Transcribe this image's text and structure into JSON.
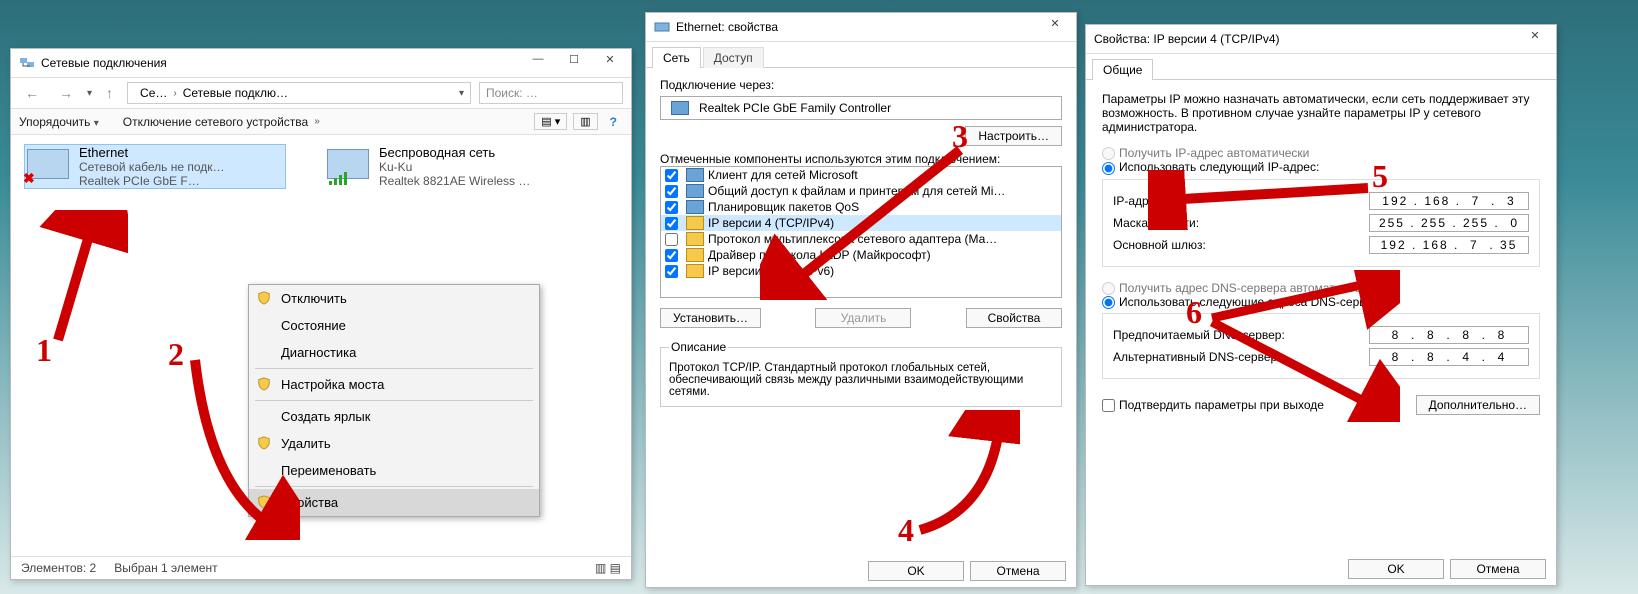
{
  "win1": {
    "title": "Сетевые подключения",
    "nav_back": "←",
    "nav_fwd": "→",
    "crumb1": "Се…",
    "crumb2": "Сетевые подклю…",
    "search_placeholder": "Поиск: …",
    "toolbar_sort": "Упорядочить",
    "toolbar_disable": "Отключение сетевого устройства",
    "adapter1": {
      "name": "Ethernet",
      "status": "Сетевой кабель не подк…",
      "driver": "Realtek PCIe GbE F…"
    },
    "adapter2": {
      "name": "Беспроводная сеть",
      "status": "Ku-Ku",
      "driver": "Realtek 8821AE Wireless …"
    },
    "ctx": {
      "disable": "Отключить",
      "state": "Состояние",
      "diag": "Диагностика",
      "bridge": "Настройка моста",
      "shortcut": "Создать ярлык",
      "delete": "Удалить",
      "rename": "Переименовать",
      "props": "Свойства"
    },
    "status_count": "Элементов: 2",
    "status_sel": "Выбран 1 элемент"
  },
  "win2": {
    "title": "Ethernet: свойства",
    "tab_net": "Сеть",
    "tab_access": "Доступ",
    "conn_via": "Подключение через:",
    "nic": "Realtek PCIe GbE Family Controller",
    "btn_config": "Настроить…",
    "components_lbl": "Отмеченные компоненты используются этим подключением:",
    "items": [
      "Клиент для сетей Microsoft",
      "Общий доступ к файлам и принтерам для сетей Mi…",
      "Планировщик пакетов QoS",
      "IP версии 4 (TCP/IPv4)",
      "Протокол мультиплексора сетевого адаптера (Ма…",
      "Драйвер протокола LLDP (Майкрософт)",
      "IP версии 6 (TCP/IPv6)"
    ],
    "btn_install": "Установить…",
    "btn_remove": "Удалить",
    "btn_props": "Свойства",
    "desc_lbl": "Описание",
    "desc_text": "Протокол TCP/IP. Стандартный протокол глобальных сетей, обеспечивающий связь между различными взаимодействующими сетями.",
    "ok": "OK",
    "cancel": "Отмена"
  },
  "win3": {
    "title": "Свойства: IP версии 4 (TCP/IPv4)",
    "tab_general": "Общие",
    "intro": "Параметры IP можно назначать автоматически, если сеть поддерживает эту возможность. В противном случае узнайте параметры IP у сетевого администратора.",
    "r_auto_ip": "Получить IP-адрес автоматически",
    "r_manual_ip": "Использовать следующий IP-адрес:",
    "ip_lbl": "IP-адрес:",
    "mask_lbl": "Маска подсети:",
    "gw_lbl": "Основной шлюз:",
    "ip": "192 . 168 .  7  .  3",
    "mask": "255 . 255 . 255 .  0",
    "gw": "192 . 168 .  7  . 35",
    "r_auto_dns": "Получить адрес DNS-сервера автоматически",
    "r_manual_dns": "Использовать следующие адреса DNS-серверов:",
    "dns1_lbl": "Предпочитаемый DNS-сервер:",
    "dns2_lbl": "Альтернативный DNS-сервер:",
    "dns1": "8  .  8  .  8  .  8",
    "dns2": "8  .  8  .  4  .  4",
    "validate": "Подтвердить параметры при выходе",
    "advanced": "Дополнительно…",
    "ok": "OK",
    "cancel": "Отмена"
  },
  "annotations": {
    "n1": "1",
    "n2": "2",
    "n3": "3",
    "n4": "4",
    "n5": "5",
    "n6": "6"
  }
}
